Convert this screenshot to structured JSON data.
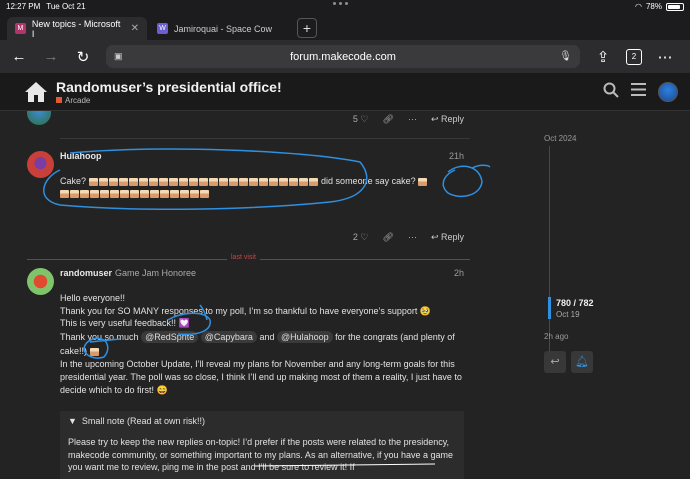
{
  "status": {
    "time": "12:27 PM",
    "date": "Tue Oct 21",
    "battery": "78%"
  },
  "tabs": [
    {
      "label": "New topics - Microsoft I",
      "active": true
    },
    {
      "label": "Jamiroquai - Space Cow",
      "active": false
    }
  ],
  "address": {
    "url": "forum.makecode.com",
    "tab_count": "2"
  },
  "topic": {
    "title": "Randomuser’s presidential office!",
    "category": "Arcade"
  },
  "posts": {
    "prev": {
      "likes": "5",
      "reply_label": "Reply"
    },
    "hulahoop": {
      "username": "Hulahoop",
      "time": "21h",
      "text_start": "Cake?",
      "text_mid": "did someone say cake?",
      "likes": "2",
      "reply_label": "Reply"
    },
    "randomuser": {
      "username": "randomuser",
      "group": "Game Jam Honoree",
      "time": "2h",
      "line1": "Hello everyone!!",
      "line2": "Thank you for SO MANY responses to my poll, I’m so thankful to have everyone’s support 🥹",
      "line3": "This is very useful feedback!! 💟",
      "line4a": "Thank you so much",
      "mention1": "@RedSprite",
      "mention2": "@Capybara",
      "line4b": "and",
      "mention3": "@Hulahoop",
      "line4c": "for the congrats (and plenty of cake!!)",
      "line5": "In the upcoming October Update, I’ll reveal my plans for November and any long-term goals for this presidential year. The poll was so close, I think I’ll end up making most of them a reality, I just have to decide which to do first! 😄",
      "details_summary": "Small note (Read at own risk!!)",
      "details_text": "Please try to keep the new replies on-topic! I’d prefer if the posts were related to the presidency, makecode community, or something important to my plans. As an alternative, if you have a game you want me to review, ping me in the post and I’ll be sure to review it! If"
    }
  },
  "last_visit_label": "last visit",
  "timeline": {
    "start_date": "Oct 2024",
    "position": "780 / 782",
    "position_date": "Oct 19",
    "ago": "2h ago"
  }
}
